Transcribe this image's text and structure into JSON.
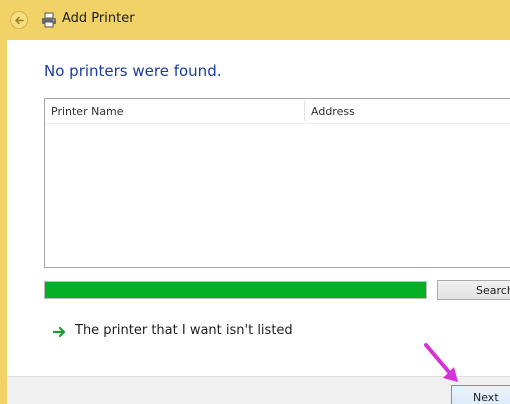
{
  "window": {
    "title": "Add Printer",
    "back_icon": "back-arrow-icon",
    "app_icon": "printer-icon"
  },
  "main": {
    "heading": "No printers were found.",
    "list": {
      "columns": [
        "Printer Name",
        "Address"
      ],
      "rows": []
    },
    "progress": {
      "fraction": 1.0,
      "color": "#06b025"
    },
    "search_label": "Search",
    "link": {
      "icon": "green-arrow-icon",
      "text": "The printer that I want isn't listed"
    }
  },
  "footer": {
    "next_label": "Next"
  },
  "colors": {
    "title_bar": "#f0d266",
    "heading": "#1a3e9e",
    "annotation_arrow": "#d633d6"
  }
}
